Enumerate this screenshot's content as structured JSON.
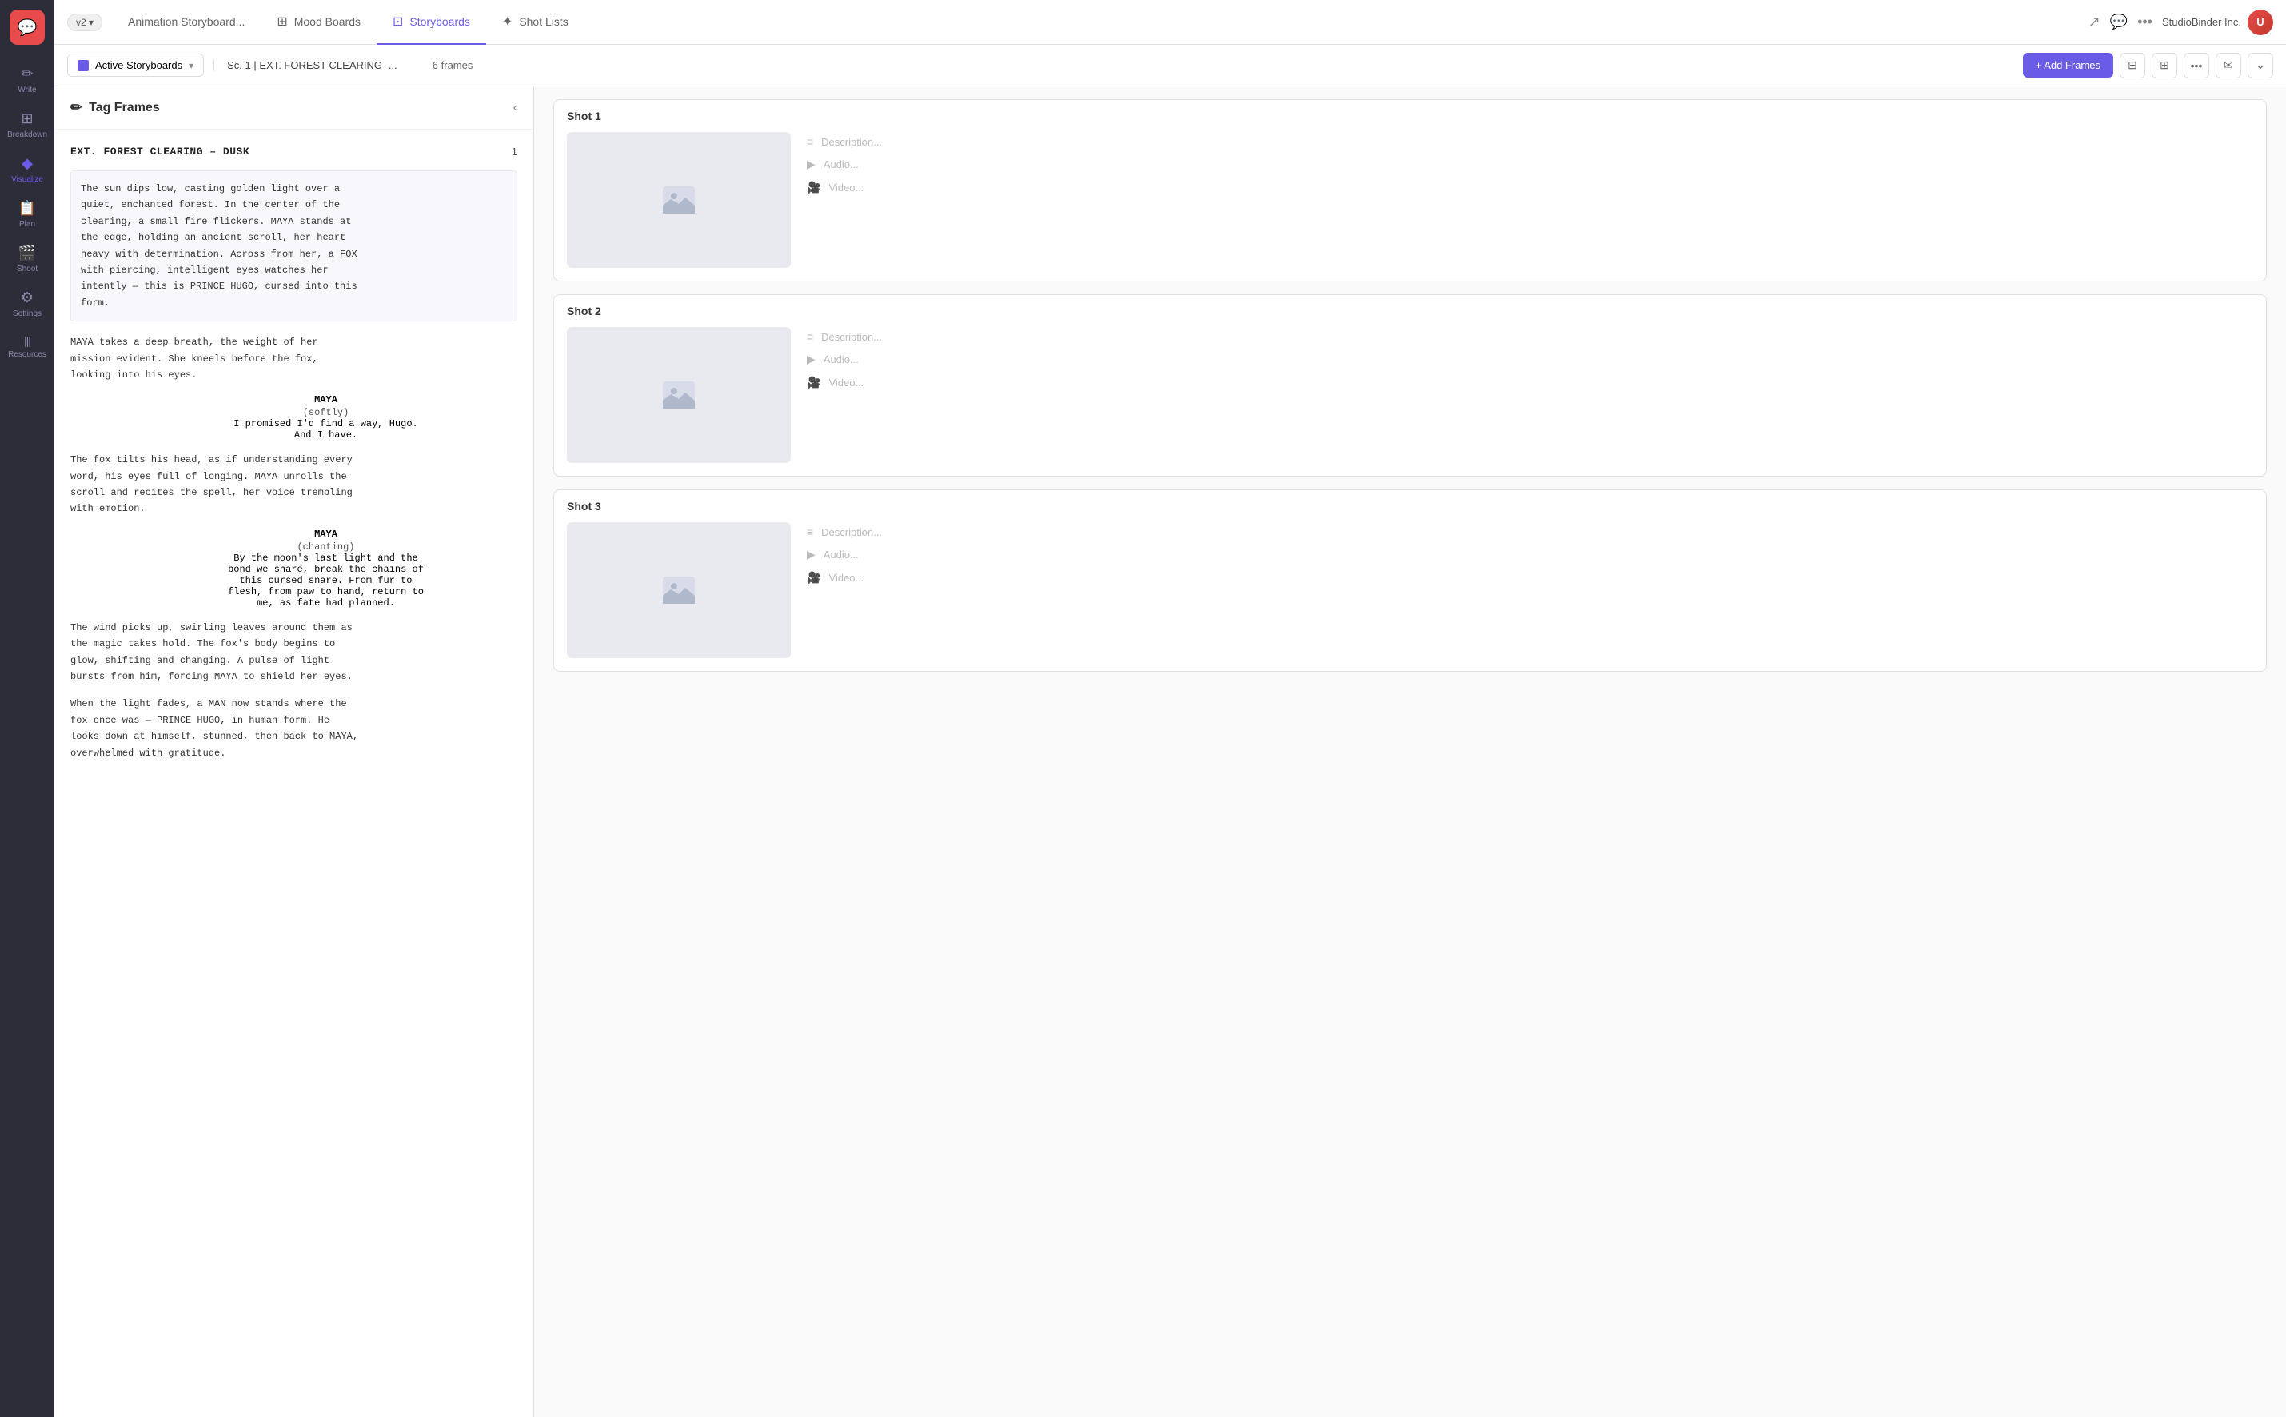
{
  "sidebar": {
    "logo": "💬",
    "items": [
      {
        "id": "write",
        "label": "Write",
        "icon": "✏️",
        "active": false
      },
      {
        "id": "breakdown",
        "label": "Breakdown",
        "icon": "⊞",
        "active": false
      },
      {
        "id": "visualize",
        "label": "Visualize",
        "icon": "◆",
        "active": true
      },
      {
        "id": "plan",
        "label": "Plan",
        "icon": "📋",
        "active": false
      },
      {
        "id": "shoot",
        "label": "Shoot",
        "icon": "🎬",
        "active": false
      },
      {
        "id": "settings",
        "label": "Settings",
        "icon": "⚙️",
        "active": false
      },
      {
        "id": "resources",
        "label": "Resources",
        "icon": "|||",
        "active": false
      }
    ]
  },
  "tabbar": {
    "version": "v2 ▾",
    "project_name": "Animation Storyboard...",
    "tabs": [
      {
        "id": "mood-boards",
        "label": "Mood Boards",
        "icon": "⊞",
        "active": false
      },
      {
        "id": "storyboards",
        "label": "Storyboards",
        "icon": "⊡",
        "active": true
      },
      {
        "id": "shot-lists",
        "label": "Shot Lists",
        "icon": "✦",
        "active": false
      }
    ],
    "right_icons": [
      "↗",
      "💬",
      "•••"
    ],
    "company": "StudioBinder Inc.",
    "user_initials": "U"
  },
  "toolbar": {
    "storyboard_select": "Active Storyboards",
    "scene_label": "Sc. 1  |  EXT. FOREST CLEARING -...",
    "frames_count": "6 frames",
    "add_frames_label": "+ Add Frames",
    "icon_buttons": [
      "⊟",
      "⊞",
      "•••",
      "✉",
      "⌄"
    ]
  },
  "script_panel": {
    "title": "Tag Frames",
    "icon": "✏",
    "scene_heading": "EXT. FOREST CLEARING – DUSK",
    "scene_number": "1",
    "action_block_1": "The sun dips low, casting golden light over a\nquiet, enchanted forest. In the center of the\nclearing, a small fire flickers. MAYA stands at\nthe edge, holding an ancient scroll, her heart\nheavy with determination. Across from her, a FOX\nwith piercing, intelligent eyes watches her\nintently — this is PRINCE HUGO, cursed into this\nform.",
    "action_block_2": "MAYA takes a deep breath, the weight of her\nmission evident. She kneels before the fox,\nlooking into his eyes.",
    "character_1": "MAYA",
    "parenthetical_1": "(softly)",
    "dialogue_1": "I promised I'd find a way, Hugo.\nAnd I have.",
    "action_block_3": "The fox tilts his head, as if understanding every\nword, his eyes full of longing. MAYA unrolls the\nscroll and recites the spell, her voice trembling\nwith emotion.",
    "character_2": "MAYA",
    "parenthetical_2": "(chanting)",
    "dialogue_2": "By the moon's last light and the\nbond we share, break the chains of\nthis cursed snare. From fur to\nflesh, from paw to hand, return to\nme, as fate had planned.",
    "action_block_4": "The wind picks up, swirling leaves around them as\nthe magic takes hold. The fox's body begins to\nglow, shifting and changing. A pulse of light\nbursts from him, forcing MAYA to shield her eyes.",
    "action_block_5": "When the light fades, a MAN now stands where the\nfox once was — PRINCE HUGO, in human form. He\nlooks down at himself, stunned, then back to MAYA,\noverwhelmed with gratitude."
  },
  "shots": [
    {
      "id": "shot-1",
      "label": "Shot  1",
      "description_placeholder": "Description...",
      "audio_placeholder": "Audio...",
      "video_placeholder": "Video..."
    },
    {
      "id": "shot-2",
      "label": "Shot  2",
      "description_placeholder": "Description...",
      "audio_placeholder": "Audio...",
      "video_placeholder": "Video..."
    },
    {
      "id": "shot-3",
      "label": "Shot  3",
      "description_placeholder": "Description...",
      "audio_placeholder": "Audio...",
      "video_placeholder": "Video..."
    }
  ],
  "colors": {
    "accent": "#6b5ce7",
    "sidebar_bg": "#2d2d3a",
    "logo_red": "#e84b4b"
  }
}
